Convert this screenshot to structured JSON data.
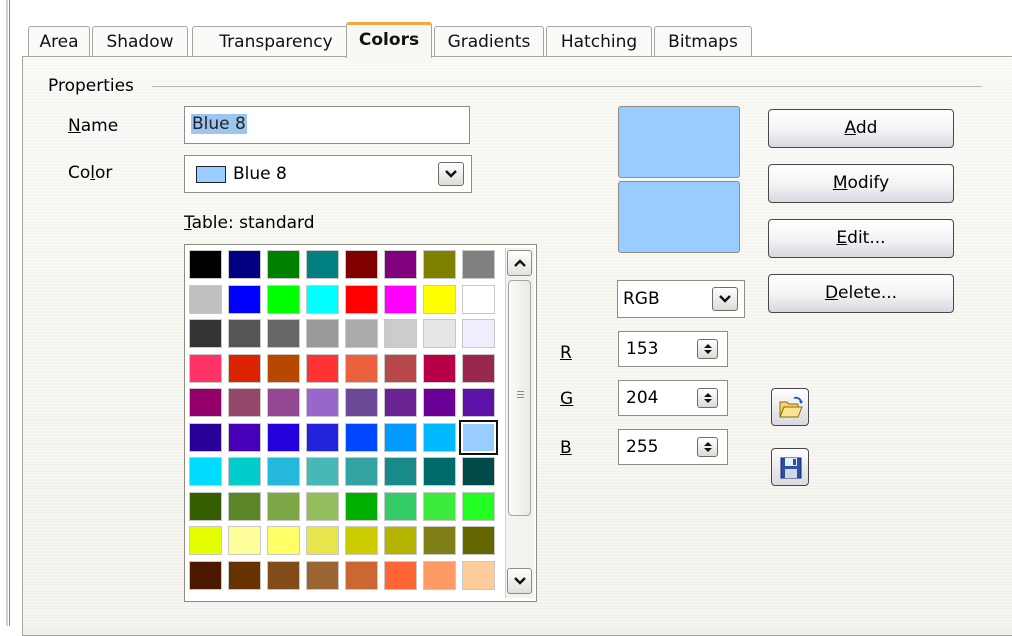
{
  "tabs": [
    "Area",
    "Shadow",
    "Transparency",
    "Colors",
    "Gradients",
    "Hatching",
    "Bitmaps"
  ],
  "active_tab": "Colors",
  "properties": {
    "group_title": "Properties",
    "name_label": "Name",
    "name_value": "Blue 8",
    "color_label": "Color",
    "color_value": "Blue 8",
    "table_label": "Table: standard"
  },
  "selected_color": "#99ccff",
  "palette": [
    [
      "#000000",
      "#000080",
      "#008000",
      "#008080",
      "#800000",
      "#800080",
      "#808000",
      "#808080"
    ],
    [
      "#c0c0c0",
      "#0000ff",
      "#00ff00",
      "#00ffff",
      "#ff0000",
      "#ff00ff",
      "#ffff00",
      "#ffffff"
    ],
    [
      "#333333",
      "#555555",
      "#666666",
      "#999999",
      "#aaaaaa",
      "#cccccc",
      "#e6e6e6",
      "#eeeeff"
    ],
    [
      "#ff3366",
      "#dc2300",
      "#b84700",
      "#ff3333",
      "#eb613d",
      "#b84747",
      "#b80047",
      "#99284c"
    ],
    [
      "#94006b",
      "#94476b",
      "#944794",
      "#9966cc",
      "#6b4794",
      "#6b2394",
      "#6b0094",
      "#5e11a6"
    ],
    [
      "#280099",
      "#4700b8",
      "#2300dc",
      "#2323dc",
      "#0047ff",
      "#0099ff",
      "#00b8ff",
      "#99ccff"
    ],
    [
      "#00dcff",
      "#00cccc",
      "#23b8dc",
      "#47b8b8",
      "#33a3a3",
      "#198a8a",
      "#006b6b",
      "#004a4a"
    ],
    [
      "#355e00",
      "#5c8526",
      "#7da647",
      "#94bd5e",
      "#00ae00",
      "#33cc66",
      "#3deb3d",
      "#23ff23"
    ],
    [
      "#e6ff00",
      "#ffff99",
      "#ffff66",
      "#e6e64c",
      "#cccc00",
      "#b3b300",
      "#808019",
      "#666600"
    ],
    [
      "#4c1900",
      "#663300",
      "#804c19",
      "#996633",
      "#cc6633",
      "#ff6633",
      "#ff9966",
      "#ffcc99"
    ]
  ],
  "selected_cell": [
    5,
    7
  ],
  "model": "RGB",
  "rgb": {
    "r_label": "R",
    "r_value": "153",
    "g_label": "G",
    "g_value": "204",
    "b_label": "B",
    "b_value": "255"
  },
  "buttons": {
    "add": "Add",
    "modify": "Modify",
    "edit": "Edit...",
    "delete": "Delete..."
  },
  "icons": [
    "open-folder-icon",
    "save-floppy-icon",
    "chevron-down-icon",
    "chevron-up-icon",
    "spin-updown-icon"
  ]
}
